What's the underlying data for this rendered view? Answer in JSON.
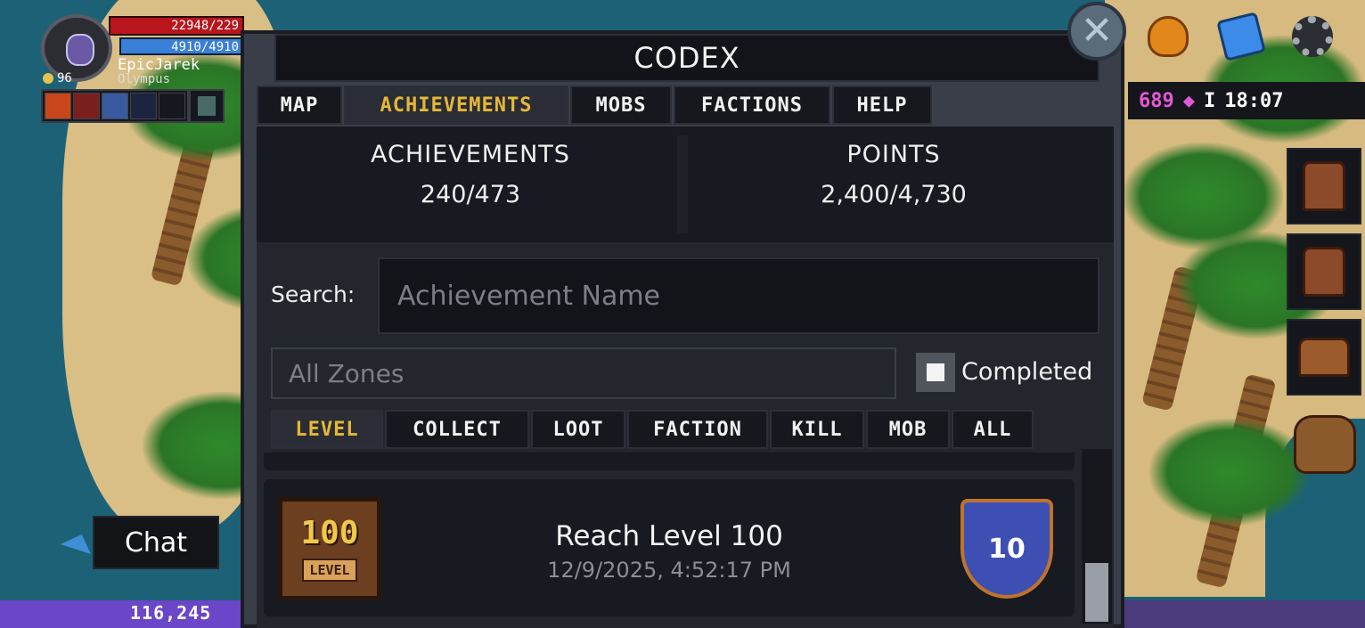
{
  "player": {
    "hp": "22948/229",
    "mp": "4910/4910",
    "name": "EpicJarek",
    "guild": "Olympus",
    "level": "96"
  },
  "hud": {
    "gems": "689",
    "clock": "18:07",
    "separator": "I",
    "xp": "116,245",
    "chat_label": "Chat",
    "close_glyph": "✕"
  },
  "codex": {
    "title": "CODEX",
    "tabs": [
      {
        "label": "MAP",
        "active": false
      },
      {
        "label": "ACHIEVEMENTS",
        "active": true
      },
      {
        "label": "MOBS",
        "active": false
      },
      {
        "label": "FACTIONS",
        "active": false
      },
      {
        "label": "HELP",
        "active": false
      }
    ],
    "stats": {
      "achievements_label": "ACHIEVEMENTS",
      "achievements_value": "240/473",
      "points_label": "POINTS",
      "points_value": "2,400/4,730"
    },
    "search": {
      "label": "Search:",
      "placeholder": "Achievement Name",
      "value": ""
    },
    "zones": {
      "selected": "All Zones"
    },
    "completed": {
      "label": "Completed",
      "checked": false
    },
    "filters": [
      {
        "label": "LEVEL",
        "active": true
      },
      {
        "label": "COLLECT",
        "active": false
      },
      {
        "label": "LOOT",
        "active": false
      },
      {
        "label": "FACTION",
        "active": false
      },
      {
        "label": "KILL",
        "active": false
      },
      {
        "label": "MOB",
        "active": false
      },
      {
        "label": "ALL",
        "active": false
      }
    ],
    "achievements": [
      {
        "title": "Reach Level 100",
        "date": "12/9/2025, 4:52:17 PM",
        "icon_number": "100",
        "icon_caption": "LEVEL",
        "points": "10"
      }
    ]
  },
  "colors": {
    "accent_tab": "#e7b736",
    "gem": "#e458d4",
    "hp": "#b8161c",
    "mp": "#3a7fd8",
    "xp_bar": "#6b46c8",
    "shield": "#3d4fb3"
  },
  "icons": {
    "close": "close-icon",
    "lion": "lion-crest-icon",
    "mail": "mail-icon",
    "settings": "gear-icon",
    "gem": "gem-icon",
    "chat": "fish-chat-icon"
  }
}
